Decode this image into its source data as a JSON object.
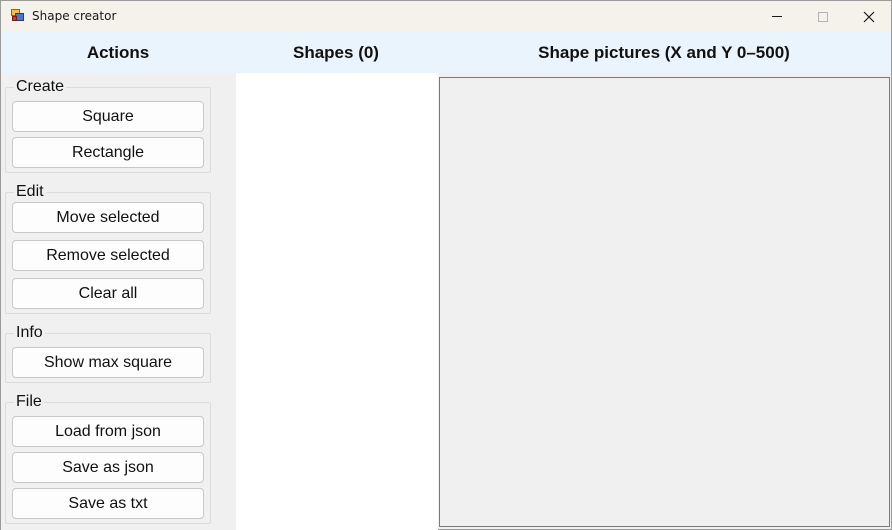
{
  "window": {
    "title": "Shape creator"
  },
  "headers": {
    "actions": "Actions",
    "shapes": "Shapes (0)",
    "pictures": "Shape pictures (X and Y 0–500)"
  },
  "groups": {
    "create": {
      "title": "Create",
      "buttons": [
        "Square",
        "Rectangle"
      ]
    },
    "edit": {
      "title": "Edit",
      "buttons": [
        "Move selected",
        "Remove selected",
        "Clear all"
      ]
    },
    "info": {
      "title": "Info",
      "buttons": [
        "Show max square"
      ]
    },
    "file": {
      "title": "File",
      "buttons": [
        "Load from json",
        "Save as json",
        "Save as txt"
      ]
    }
  },
  "shapes": [],
  "icons": {
    "app": "app-icon",
    "minimize": "minimize-icon",
    "maximize": "maximize-icon",
    "close": "close-icon"
  }
}
